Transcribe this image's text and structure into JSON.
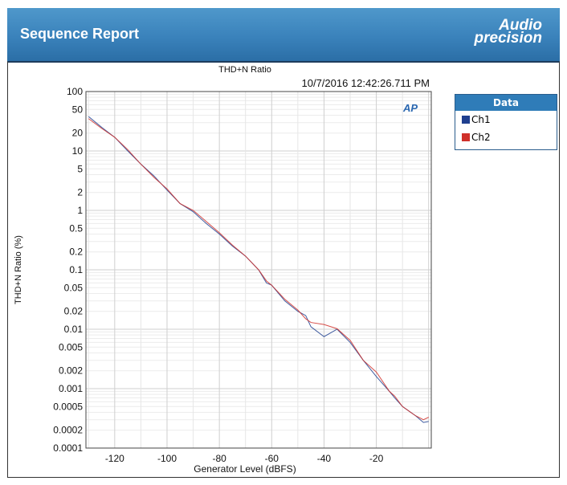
{
  "header": {
    "title": "Sequence Report",
    "logo_line1": "Audio",
    "logo_line2": "precision"
  },
  "chart_data": {
    "type": "line",
    "title": "THD+N Ratio",
    "timestamp": "10/7/2016 12:42:26.711 PM",
    "watermark": "AP",
    "xlabel": "Generator Level (dBFS)",
    "ylabel": "THD+N Ratio (%)",
    "xlim": [
      -131,
      1
    ],
    "ylim": [
      0.0001,
      100
    ],
    "yscale": "log",
    "grid": true,
    "xticks": [
      -120,
      -100,
      -80,
      -60,
      -40,
      -20
    ],
    "xtick_labels": [
      "-120",
      "-100",
      "-80",
      "-60",
      "-40",
      "-20"
    ],
    "yticks": [
      100,
      50,
      20,
      10,
      5,
      2,
      1,
      0.5,
      0.2,
      0.1,
      0.05,
      0.02,
      0.01,
      0.005,
      0.002,
      0.001,
      0.0005,
      0.0002,
      0.0001
    ],
    "ytick_labels": [
      "100",
      "50",
      "20",
      "10",
      "5",
      "2",
      "1",
      "0.5",
      "0.2",
      "0.1",
      "0.05",
      "0.02",
      "0.01",
      "0.005",
      "0.002",
      "0.001",
      "0.0005",
      "0.0002",
      "0.0001"
    ],
    "legend": {
      "title": "Data",
      "position": "right"
    },
    "series": [
      {
        "name": "Ch1",
        "color": "#1f3f8f",
        "x": [
          -130,
          -125,
          -120,
          -115,
          -110,
          -105,
          -100,
          -95,
          -90,
          -85,
          -80,
          -75,
          -70,
          -65,
          -62,
          -60,
          -55,
          -50,
          -47,
          -45,
          -40,
          -35,
          -30,
          -25,
          -20,
          -15,
          -13,
          -10,
          -5,
          -2,
          0
        ],
        "y": [
          38,
          25,
          17,
          10,
          6,
          3.8,
          2.2,
          1.3,
          0.95,
          0.6,
          0.4,
          0.25,
          0.17,
          0.1,
          0.06,
          0.055,
          0.03,
          0.02,
          0.017,
          0.011,
          0.0075,
          0.01,
          0.006,
          0.003,
          0.0016,
          0.0009,
          0.0007,
          0.0005,
          0.00035,
          0.00027,
          0.00028
        ]
      },
      {
        "name": "Ch2",
        "color": "#d0302a",
        "x": [
          -130,
          -125,
          -120,
          -115,
          -110,
          -105,
          -100,
          -95,
          -90,
          -85,
          -80,
          -75,
          -70,
          -65,
          -62,
          -60,
          -55,
          -50,
          -47,
          -45,
          -40,
          -35,
          -30,
          -25,
          -20,
          -15,
          -13,
          -10,
          -5,
          -2,
          0
        ],
        "y": [
          35,
          24,
          17,
          10.5,
          6,
          3.6,
          2.3,
          1.3,
          1.0,
          0.65,
          0.42,
          0.26,
          0.17,
          0.1,
          0.065,
          0.055,
          0.032,
          0.021,
          0.015,
          0.013,
          0.012,
          0.0102,
          0.0065,
          0.003,
          0.0019,
          0.0009,
          0.00075,
          0.0005,
          0.00035,
          0.0003,
          0.00033
        ]
      }
    ]
  }
}
